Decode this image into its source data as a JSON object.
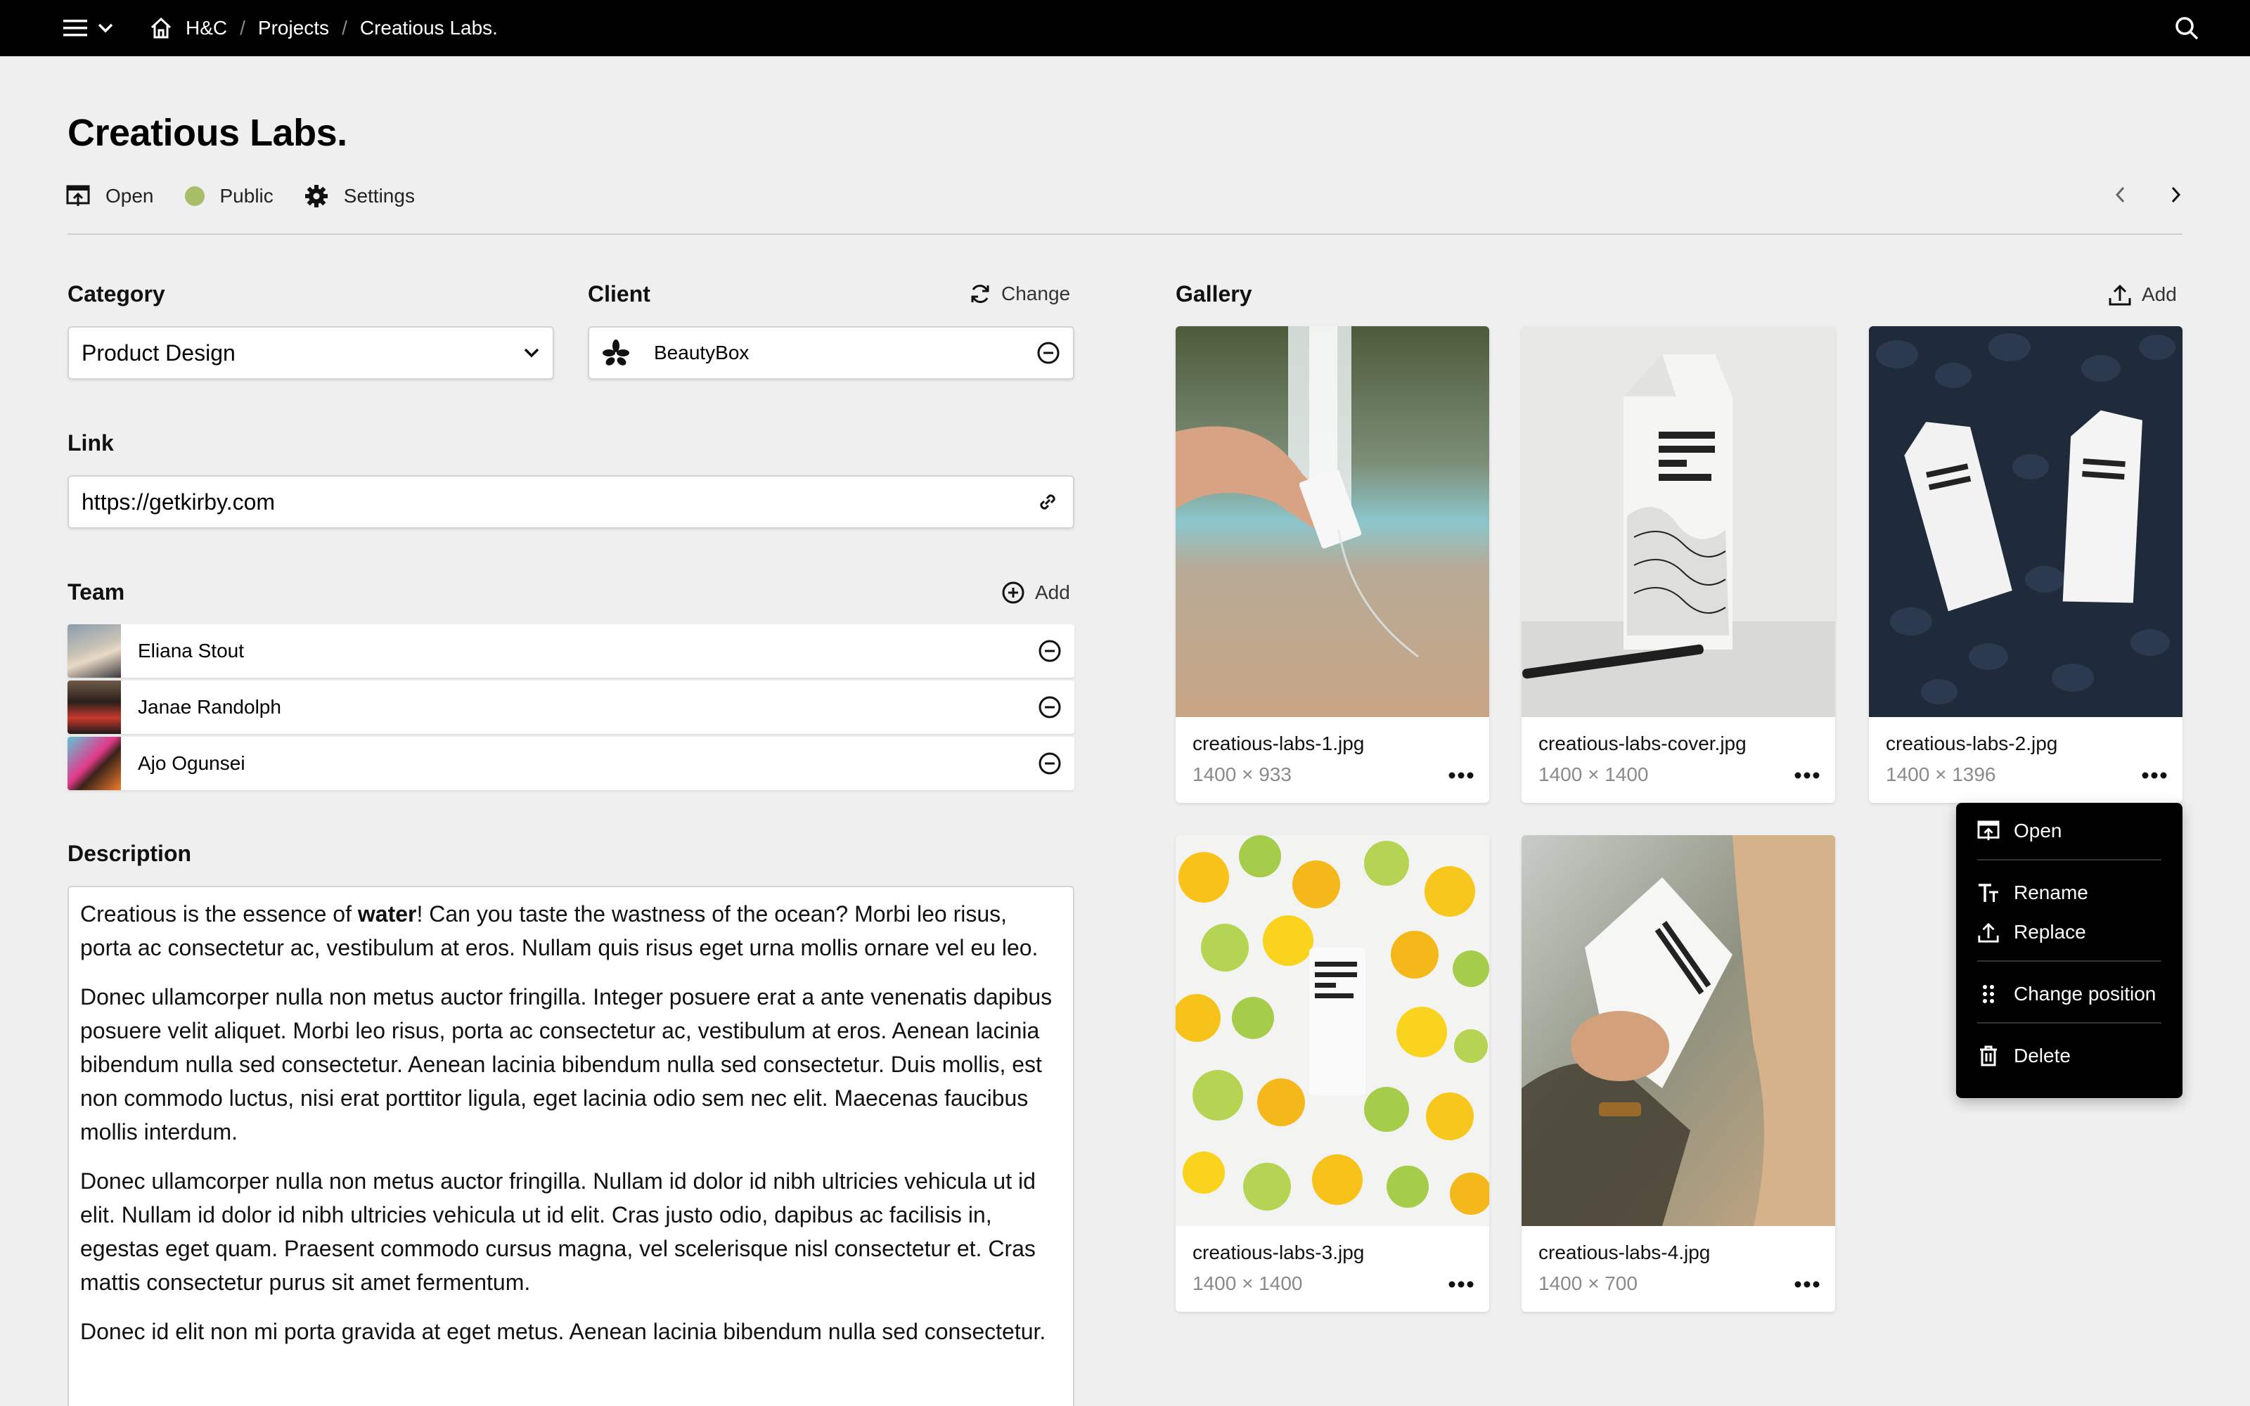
{
  "topbar": {
    "breadcrumbs": [
      "H&C",
      "Projects",
      "Creatious Labs."
    ],
    "separator": "/"
  },
  "page": {
    "title": "Creatious Labs.",
    "options": {
      "open": "Open",
      "status": "Public",
      "status_color": "#a7bd68",
      "settings": "Settings"
    }
  },
  "category": {
    "label": "Category",
    "value": "Product Design"
  },
  "client": {
    "label": "Client",
    "action": "Change",
    "value": "BeautyBox"
  },
  "link": {
    "label": "Link",
    "value": "https://getkirby.com"
  },
  "team": {
    "label": "Team",
    "action": "Add",
    "members": [
      "Eliana Stout",
      "Janae Randolph",
      "Ajo Ogunsei"
    ]
  },
  "description": {
    "label": "Description",
    "p1_a": "Creatious is the essence of ",
    "p1_bold": "water",
    "p1_b": "! Can you taste the wastness of the ocean? Morbi leo risus, porta ac consectetur ac, vestibulum at eros. Nullam quis risus eget urna mollis ornare vel eu leo.",
    "p2": "Donec ullamcorper nulla non metus auctor fringilla. Integer posuere erat a ante venenatis dapibus posuere velit aliquet. Morbi leo risus, porta ac consectetur ac, vestibulum at eros. Aenean lacinia bibendum nulla sed consectetur. Aenean lacinia bibendum nulla sed consectetur. Duis mollis, est non commodo luctus, nisi erat porttitor ligula, eget lacinia odio sem nec elit. Maecenas faucibus mollis interdum.",
    "p3": "Donec ullamcorper nulla non metus auctor fringilla. Nullam id dolor id nibh ultricies vehicula ut id elit. Nullam id dolor id nibh ultricies vehicula ut id elit. Cras justo odio, dapibus ac facilisis in, egestas eget quam. Praesent commodo cursus magna, vel scelerisque nisl consectetur et. Cras mattis consectetur purus sit amet fermentum.",
    "p4": "Donec id elit non mi porta gravida at eget metus. Aenean lacinia bibendum nulla sed consectetur."
  },
  "gallery": {
    "label": "Gallery",
    "action": "Add",
    "items": [
      {
        "filename": "creatious-labs-1.jpg",
        "dimensions": "1400 × 933"
      },
      {
        "filename": "creatious-labs-cover.jpg",
        "dimensions": "1400 × 1400"
      },
      {
        "filename": "creatious-labs-2.jpg",
        "dimensions": "1400 × 1396"
      },
      {
        "filename": "creatious-labs-3.jpg",
        "dimensions": "1400 × 1400"
      },
      {
        "filename": "creatious-labs-4.jpg",
        "dimensions": "1400 × 700"
      }
    ]
  },
  "dropdown": {
    "open": "Open",
    "rename": "Rename",
    "replace": "Replace",
    "change_position": "Change position",
    "delete": "Delete"
  }
}
